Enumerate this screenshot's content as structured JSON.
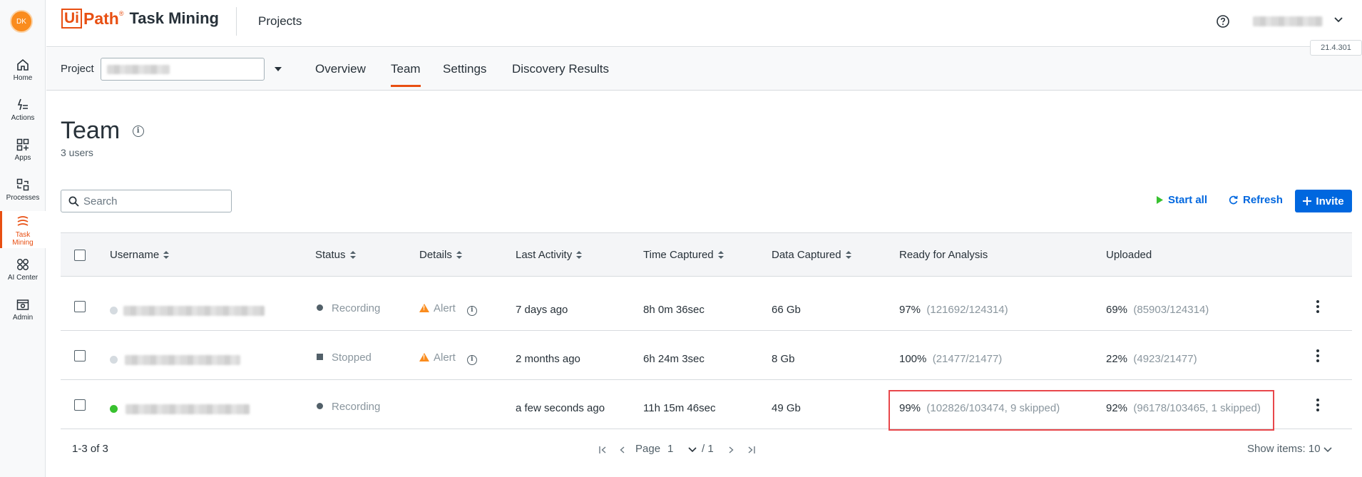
{
  "user": {
    "initials": "DK"
  },
  "rail": {
    "items": [
      {
        "label": "Home",
        "icon": "home-icon"
      },
      {
        "label": "Actions",
        "icon": "actions-icon"
      },
      {
        "label": "Apps",
        "icon": "apps-icon"
      },
      {
        "label": "Processes",
        "icon": "processes-icon"
      },
      {
        "label_line1": "Task",
        "label_line2": "Mining",
        "icon": "task-mining-icon",
        "active": true
      },
      {
        "label": "AI Center",
        "icon": "ai-center-icon"
      },
      {
        "label": "Admin",
        "icon": "admin-icon"
      }
    ]
  },
  "header": {
    "logo_ui": "Ui",
    "logo_path": "Path",
    "logo_reg": "®",
    "product": "Task Mining",
    "section": "Projects",
    "version": "21.4.301"
  },
  "projectbar": {
    "label": "Project",
    "tabs": [
      {
        "label": "Overview"
      },
      {
        "label": "Team",
        "active": true
      },
      {
        "label": "Settings"
      },
      {
        "label": "Discovery Results"
      }
    ]
  },
  "page": {
    "title": "Team",
    "info_glyph": "i",
    "user_count": "3 users",
    "search_placeholder": "Search",
    "actions": {
      "start_all": "Start all",
      "refresh": "Refresh",
      "invite": "Invite"
    }
  },
  "table": {
    "headers": {
      "username": "Username",
      "status": "Status",
      "details": "Details",
      "last_activity": "Last Activity",
      "time_captured": "Time Captured",
      "data_captured": "Data Captured",
      "ready": "Ready for Analysis",
      "uploaded": "Uploaded"
    },
    "rows": [
      {
        "online": false,
        "status": "Recording",
        "details": "Alert",
        "last_activity": "7 days ago",
        "time_captured": "8h 0m 36sec",
        "data_captured": "66 Gb",
        "ready_pct": "97%",
        "ready_detail": "(121692/124314)",
        "uploaded_pct": "69%",
        "uploaded_detail": "(85903/124314)"
      },
      {
        "online": false,
        "status": "Stopped",
        "details": "Alert",
        "last_activity": "2 months ago",
        "time_captured": "6h 24m 3sec",
        "data_captured": "8 Gb",
        "ready_pct": "100%",
        "ready_detail": "(21477/21477)",
        "uploaded_pct": "22%",
        "uploaded_detail": "(4923/21477)"
      },
      {
        "online": true,
        "status": "Recording",
        "details": "",
        "last_activity": "a few seconds ago",
        "time_captured": "11h 15m 46sec",
        "data_captured": "49 Gb",
        "ready_pct": "99%",
        "ready_detail": "(102826/103474, 9 skipped)",
        "uploaded_pct": "92%",
        "uploaded_detail": "(96178/103465, 1 skipped)"
      }
    ]
  },
  "footer": {
    "range": "1-3 of 3",
    "page_label": "Page",
    "page_value": "1",
    "page_total": "/ 1",
    "show_items": "Show items: 10"
  },
  "colors": {
    "accent": "#e84f12",
    "primary": "#0067df",
    "highlight": "#e8474b",
    "online": "#38c12f"
  }
}
